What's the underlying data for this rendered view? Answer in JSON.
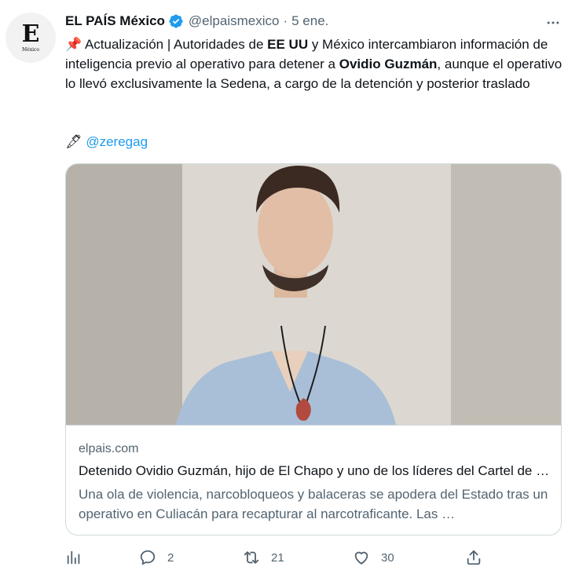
{
  "account": {
    "avatar_letter": "E",
    "avatar_subtitle": "México",
    "name": "EL PAÍS México",
    "handle": "@elpaismexico",
    "separator": "·",
    "date": "5 ene."
  },
  "tweet": {
    "pin_emoji": "📌",
    "text_segments": {
      "s1": " Actualización | Autoridades de ",
      "b1": "EE UU",
      "s2": " y México intercambiaron información de inteligencia previo al operativo para detener a ",
      "b2": "Ovidio Guzmán",
      "s3": ", aunque el operativo lo llevó exclusivamente la Sedena, a cargo de la detención y posterior traslado"
    },
    "credit_emoji": "🖋",
    "credit_handle": "@zeregag"
  },
  "card": {
    "domain": "elpais.com",
    "title": "Detenido Ovidio Guzmán, hijo de El Chapo y uno de los líderes del Cartel de Sinaloa",
    "description": "Una ola de violencia, narcobloqueos y balaceras se apodera del Estado tras un operativo en Culiacán para recapturar al narcotraficante. Las …"
  },
  "actions": {
    "replies": "2",
    "retweets": "21",
    "likes": "30"
  },
  "colors": {
    "text": "#0f1419",
    "secondary": "#536471",
    "link": "#1d9bf0",
    "verified": "#1d9bf0",
    "border": "#cfd9de"
  },
  "icons": [
    "verified-badge-icon",
    "more-options-icon",
    "analytics-icon",
    "reply-icon",
    "retweet-icon",
    "like-icon",
    "share-icon"
  ]
}
